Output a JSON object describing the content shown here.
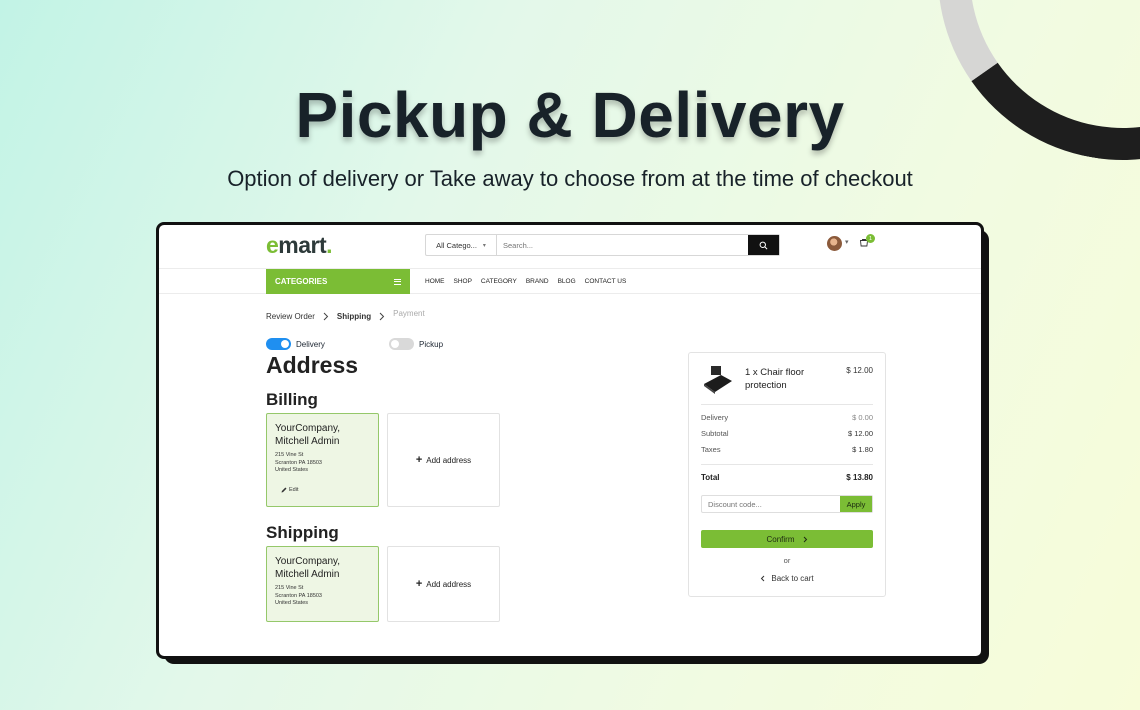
{
  "hero": {
    "title": "Pickup & Delivery",
    "subtitle": "Option of delivery or Take away to choose from at the time of checkout"
  },
  "header": {
    "logo_e": "e",
    "logo_text": "mart",
    "logo_dot": ".",
    "category_select": "All Catego...",
    "search_placeholder": "Search...",
    "cart_count": "1"
  },
  "nav": {
    "categories_label": "CATEGORIES",
    "links": [
      "HOME",
      "SHOP",
      "CATEGORY",
      "BRAND",
      "BLOG",
      "CONTACT US"
    ]
  },
  "breadcrumb": {
    "step1": "Review Order",
    "step2": "Shipping",
    "step3": "Payment"
  },
  "toggles": {
    "delivery_label": "Delivery",
    "delivery_on": true,
    "pickup_label": "Pickup",
    "pickup_on": false
  },
  "address": {
    "title": "Address",
    "billing_title": "Billing",
    "shipping_title": "Shipping",
    "add_address_label": "Add address",
    "edit_label": "Edit",
    "card": {
      "name_line1": "YourCompany,",
      "name_line2": "Mitchell Admin",
      "street": "215 Vine St",
      "city": "Scranton PA 18503",
      "country": "United States"
    }
  },
  "summary": {
    "product_name": "1 x Chair floor protection",
    "product_price": "$ 12.00",
    "delivery_label": "Delivery",
    "delivery_value": "$ 0.00",
    "subtotal_label": "Subtotal",
    "subtotal_value": "$ 12.00",
    "taxes_label": "Taxes",
    "taxes_value": "$ 1.80",
    "total_label": "Total",
    "total_value": "$ 13.80",
    "discount_placeholder": "Discount code...",
    "apply_label": "Apply",
    "confirm_label": "Confirm",
    "or_label": "or",
    "back_label": "Back to cart"
  },
  "colors": {
    "brand_green": "#7bbd35",
    "toggle_blue": "#1f8ff0",
    "selected_card_bg": "#eef6e4"
  }
}
